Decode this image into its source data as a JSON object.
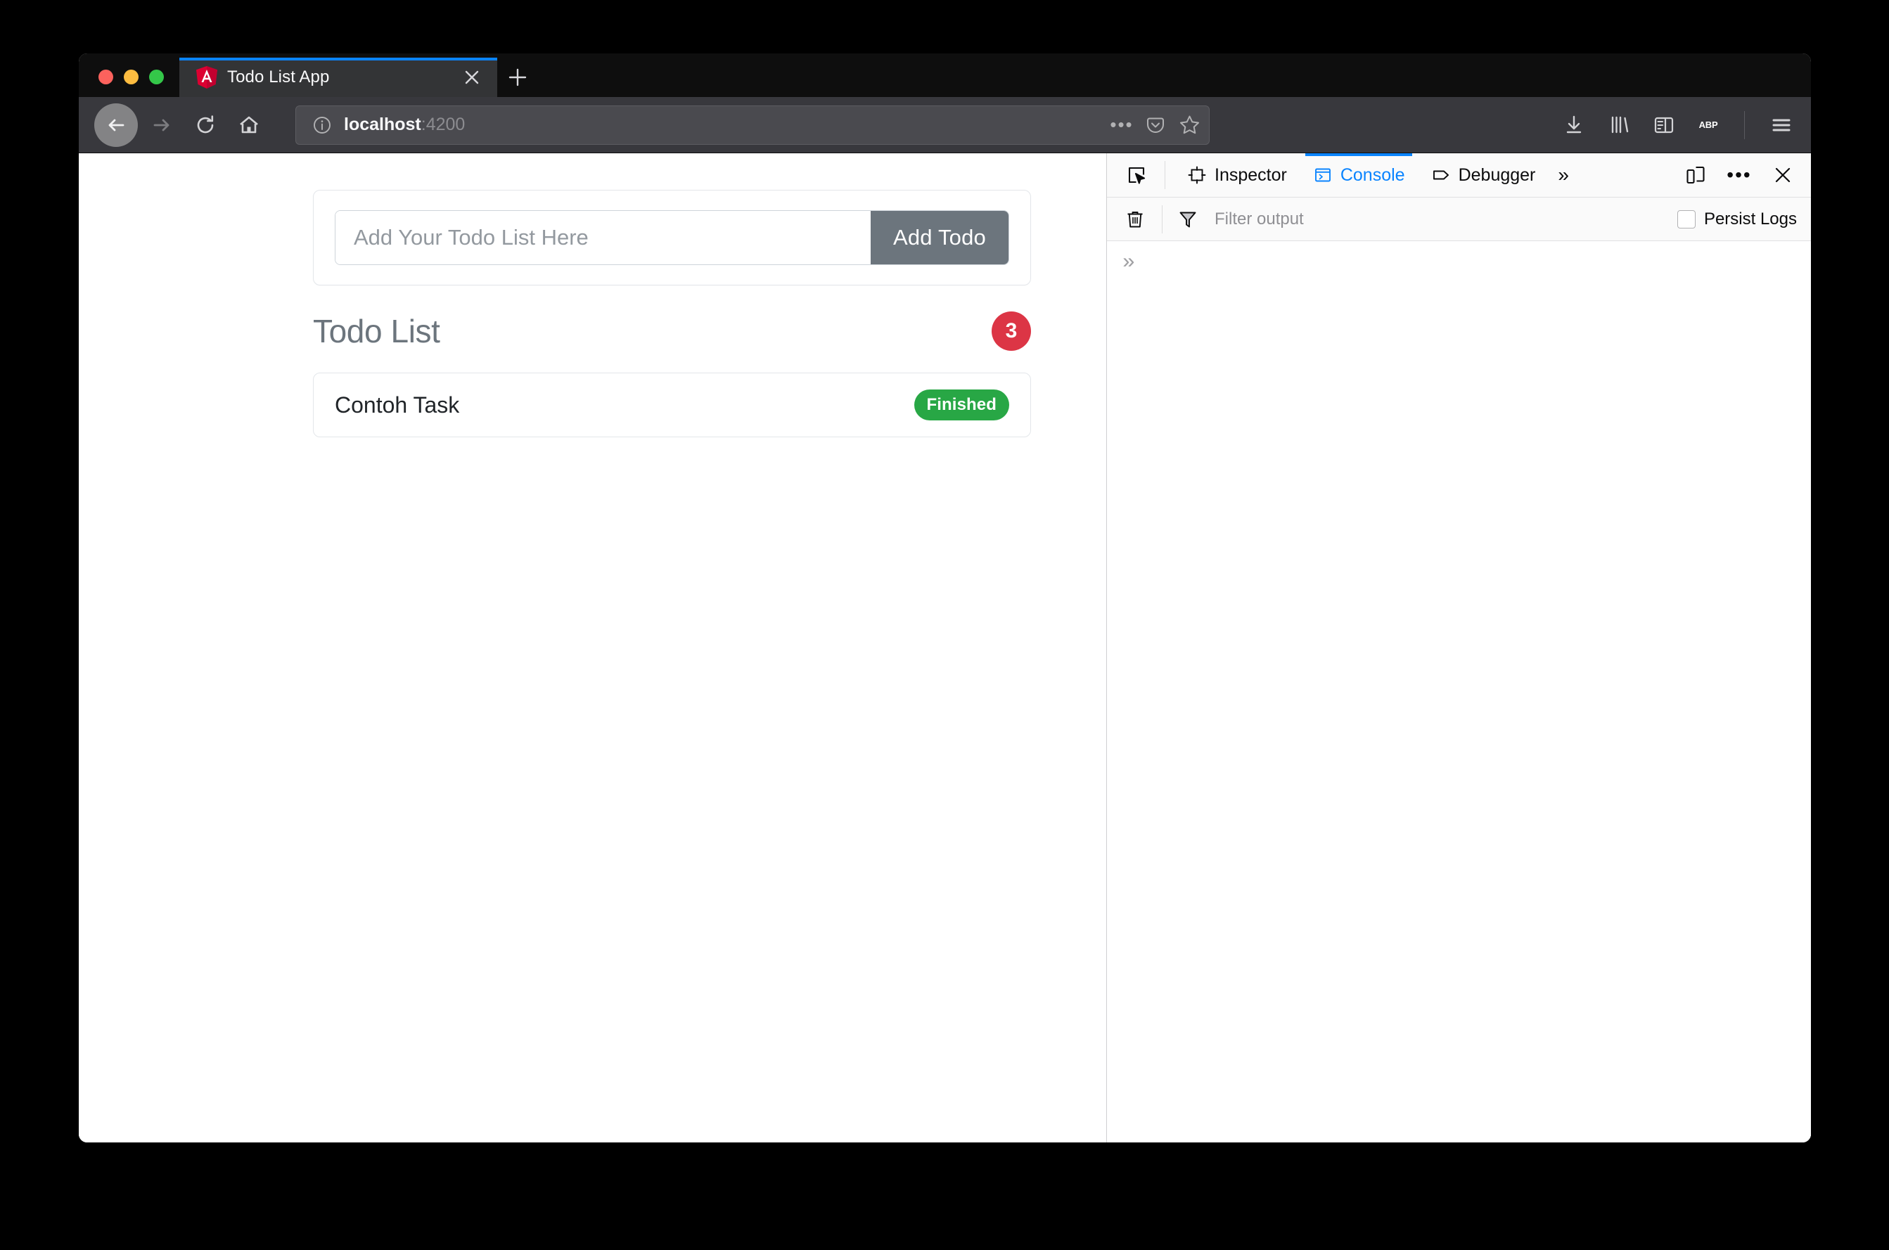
{
  "window": {
    "traffic_lights": [
      "close",
      "minimize",
      "zoom"
    ]
  },
  "tabbar": {
    "tab": {
      "favicon": "angular-logo-icon",
      "title": "Todo List App",
      "close_label": "×"
    },
    "new_tab_label": "+"
  },
  "navbar": {
    "back": "back-arrow-icon",
    "forward": "forward-arrow-icon",
    "reload": "reload-icon",
    "home": "home-icon",
    "url_host": "localhost",
    "url_path": ":4200",
    "url_full": "localhost:4200",
    "page_actions_label": "•••",
    "pocket": "pocket-icon",
    "bookmark": "star-icon",
    "downloads": "download-icon",
    "library": "library-icon",
    "sidebars": "sidebar-icon",
    "adblock_label": "ABP",
    "menu": "hamburger-menu-icon"
  },
  "page": {
    "add_form": {
      "input_value": "",
      "input_placeholder": "Add Your Todo List Here",
      "button_label": "Add Todo"
    },
    "list": {
      "title": "Todo List",
      "count": "3",
      "items": [
        {
          "text": "Contoh Task",
          "status": "Finished"
        }
      ]
    }
  },
  "devtools": {
    "picker_icon": "element-picker-icon",
    "tabs": [
      {
        "label": "Inspector",
        "icon": "inspector-icon",
        "active": false
      },
      {
        "label": "Console",
        "icon": "console-icon",
        "active": true
      },
      {
        "label": "Debugger",
        "icon": "debugger-icon",
        "active": false
      }
    ],
    "overflow_label": "»",
    "responsive_icon": "responsive-design-mode-icon",
    "meatball_label": "•••",
    "close_label": "✕",
    "filterbar": {
      "clear_icon": "trash-icon",
      "funnel_icon": "funnel-icon",
      "filter_value": "",
      "filter_placeholder": "Filter output",
      "persist_label": "Persist Logs",
      "persist_checked": false
    },
    "console": {
      "prompt": "»",
      "messages": []
    }
  },
  "colors": {
    "accent_blue": "#0a84ff",
    "badge_red": "#dc3545",
    "status_green": "#28a745",
    "button_gray": "#6c757d",
    "chrome_dark": "#38383d",
    "tabstrip_dark": "#0e0e0e"
  }
}
